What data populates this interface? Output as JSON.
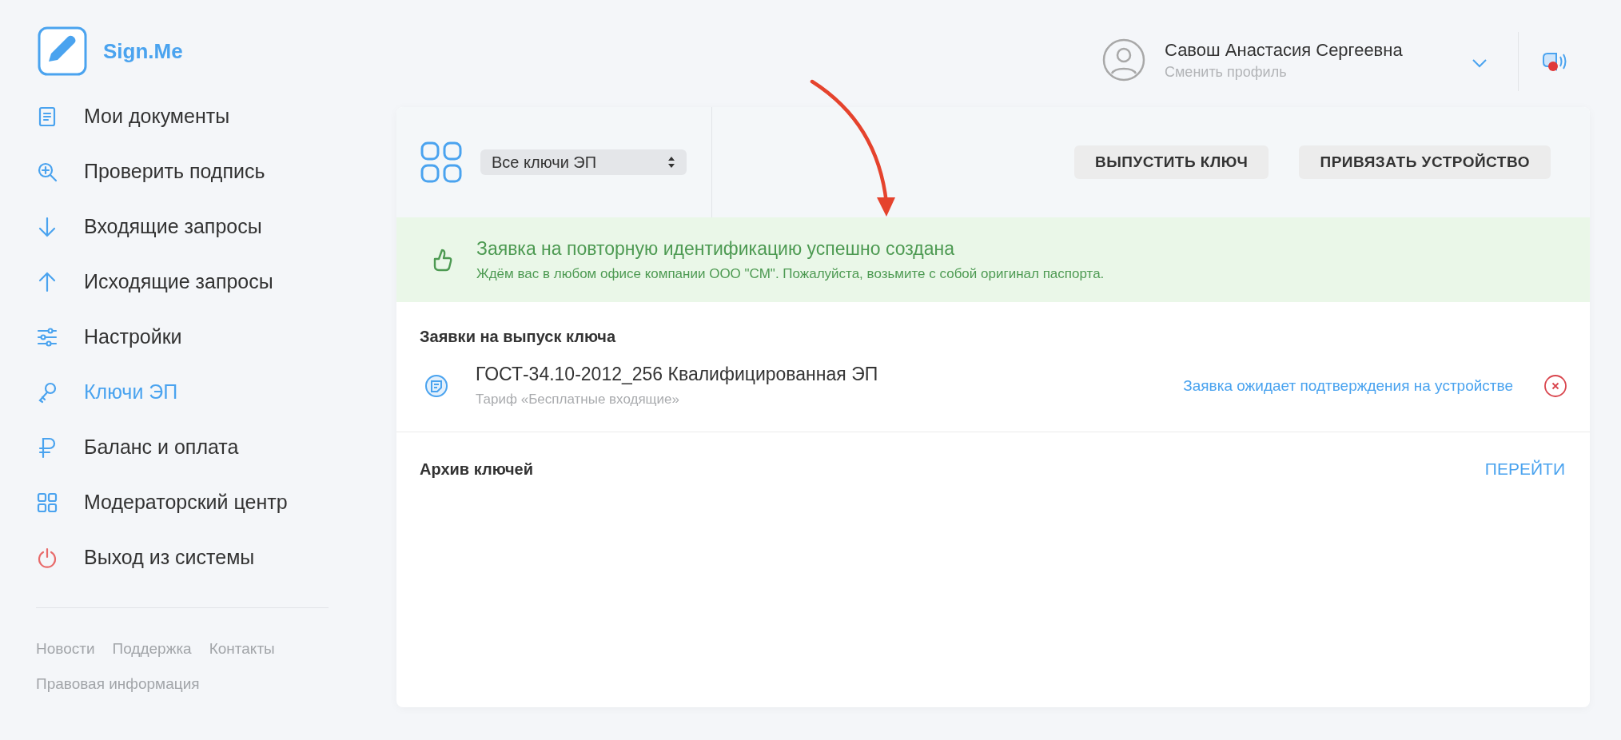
{
  "brand": {
    "name": "Sign.Me"
  },
  "nav": [
    {
      "label": "Мои документы",
      "selected": false
    },
    {
      "label": "Проверить подпись",
      "selected": false
    },
    {
      "label": "Входящие запросы",
      "selected": false
    },
    {
      "label": "Исходящие запросы",
      "selected": false
    },
    {
      "label": "Настройки",
      "selected": false
    },
    {
      "label": "Ключи ЭП",
      "selected": true
    },
    {
      "label": "Баланс и оплата",
      "selected": false
    },
    {
      "label": "Модераторский центр",
      "selected": false
    },
    {
      "label": "Выход из системы",
      "selected": false
    }
  ],
  "footer_links": [
    "Новости",
    "Поддержка",
    "Контакты",
    "Правовая информация"
  ],
  "user": {
    "name": "Савош Анастасия Сергеевна",
    "subtitle": "Сменить профиль"
  },
  "notifications": {
    "unread": true
  },
  "toolbar": {
    "filter": "Все ключи ЭП",
    "buttons": [
      "ВЫПУСТИТЬ КЛЮЧ",
      "ПРИВЯЗАТЬ УСТРОЙСТВО"
    ]
  },
  "alert": {
    "title": "Заявка на повторную идентификацию успешно создана",
    "message": "Ждём вас в любом офисе компании ООО \"СМ\". Пожалуйста, возьмите с собой оригинал паспорта."
  },
  "requests": {
    "heading": "Заявки на выпуск ключа",
    "items": [
      {
        "title": "ГОСТ-34.10-2012_256 Квалифицированная ЭП",
        "subtitle": "Тариф «Бесплатные входящие»",
        "status": "Заявка ожидает подтверждения на устройстве"
      }
    ]
  },
  "archive": {
    "heading": "Архив ключей",
    "link": "ПЕРЕЙТИ"
  }
}
